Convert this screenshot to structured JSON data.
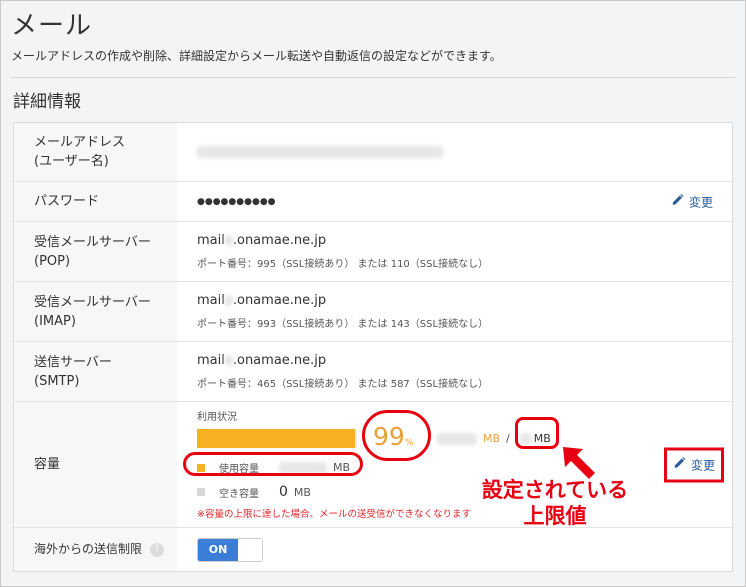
{
  "header": {
    "title": "メール",
    "description": "メールアドレスの作成や削除、詳細設定からメール転送や自動返信の設定などができます。",
    "section_title": "詳細情報"
  },
  "rows": {
    "address": {
      "label1": "メールアドレス",
      "label2": "(ユーザー名)"
    },
    "password": {
      "label": "パスワード",
      "value": "●●●●●●●●●●",
      "edit": "変更"
    },
    "pop": {
      "label1": "受信メールサーバー",
      "label2": "(POP)",
      "host_prefix": "mail",
      "host_suffix": ".onamae.ne.jp",
      "ports": "ポート番号：995（SSL接続あり）  または 110（SSL接続なし）"
    },
    "imap": {
      "label1": "受信メールサーバー",
      "label2": "(IMAP)",
      "host_prefix": "mail",
      "host_suffix": ".onamae.ne.jp",
      "ports": "ポート番号：993（SSL接続あり）  または 143（SSL接続なし）"
    },
    "smtp": {
      "label1": "送信サーバー",
      "label2": "(SMTP)",
      "host_prefix": "mail",
      "host_suffix": ".onamae.ne.jp",
      "ports": "ポート番号：465（SSL接続あり）  または 587（SSL接続なし）"
    },
    "capacity": {
      "label": "容量",
      "usage_label": "利用状況",
      "percent": "99",
      "percent_unit": "%",
      "percent_value": 0.99,
      "mb_unit": "MB",
      "slash": "/",
      "used_label": "使用容量",
      "free_label": "空き容量",
      "free_value": "0",
      "warning": "※容量の上限に達した場合、メールの送受信ができなくなります",
      "edit": "変更",
      "used_color": "#f6b223",
      "free_color": "#d8d8d8"
    },
    "overseas": {
      "label": "海外からの送信制限",
      "help": "?",
      "toggle": "ON"
    }
  },
  "annotation": {
    "line1": "設定されている",
    "line2": "上限値"
  }
}
